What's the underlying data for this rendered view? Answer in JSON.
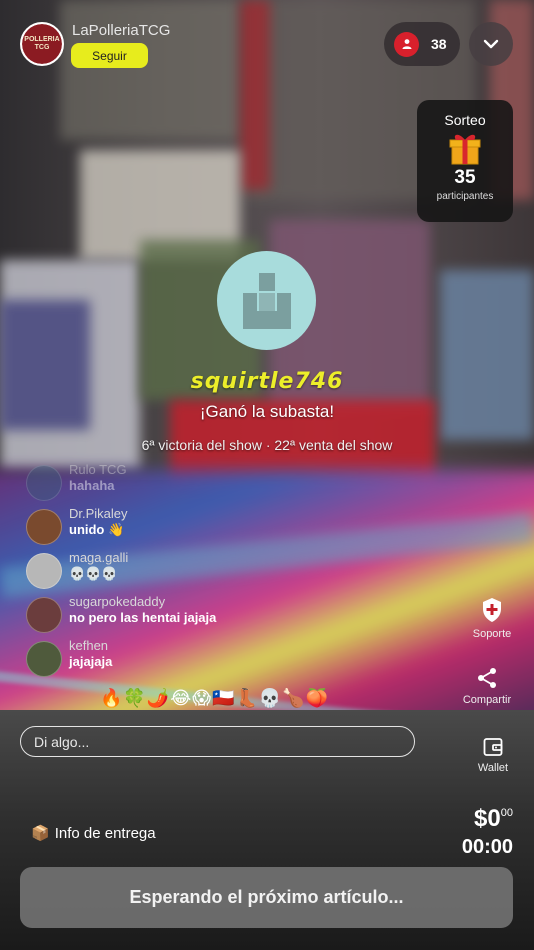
{
  "header": {
    "shop_name": "LaPolleriaTCG",
    "shop_logo_text": "POLLERIA TCG",
    "follow_label": "Seguir",
    "viewer_count": "38"
  },
  "giveaway": {
    "title": "Sorteo",
    "count": "35",
    "label": "participantes"
  },
  "winner": {
    "username": "squirtle746",
    "message": "¡Ganó la subasta!",
    "stats": "6ª victoria del show · 22ª venta del show"
  },
  "chat": {
    "messages": [
      {
        "user": "Rulo TCG",
        "text": "hahaha",
        "avatar_color": "#3b5a78"
      },
      {
        "user": "Dr.Pikaley",
        "text": "unido 👋",
        "avatar_color": "#7a4a2e"
      },
      {
        "user": "maga.galli",
        "text": "💀💀💀",
        "avatar_color": "#b7b7b7"
      },
      {
        "user": "sugarpokedaddy",
        "text": "no pero las hentai jajaja",
        "avatar_color": "#6b3d3d"
      },
      {
        "user": "kefhen",
        "text": "jajajaja",
        "avatar_color": "#4f5a3c"
      }
    ],
    "emojis": "🔥🍀🌶️😂😱🇨🇱👢💀🍗🍑",
    "input_placeholder": "Di algo..."
  },
  "actions": {
    "support_label": "Soporte",
    "share_label": "Compartir",
    "wallet_label": "Wallet"
  },
  "footer": {
    "delivery_label": "Info de entrega",
    "price_main": "$0",
    "price_cents": "00",
    "timer": "00:00",
    "wait_label": "Esperando el próximo artículo..."
  },
  "colors": {
    "accent_yellow": "#e7ec1d",
    "viewer_red": "#d8202c",
    "winner_name": "#ecee2a"
  }
}
